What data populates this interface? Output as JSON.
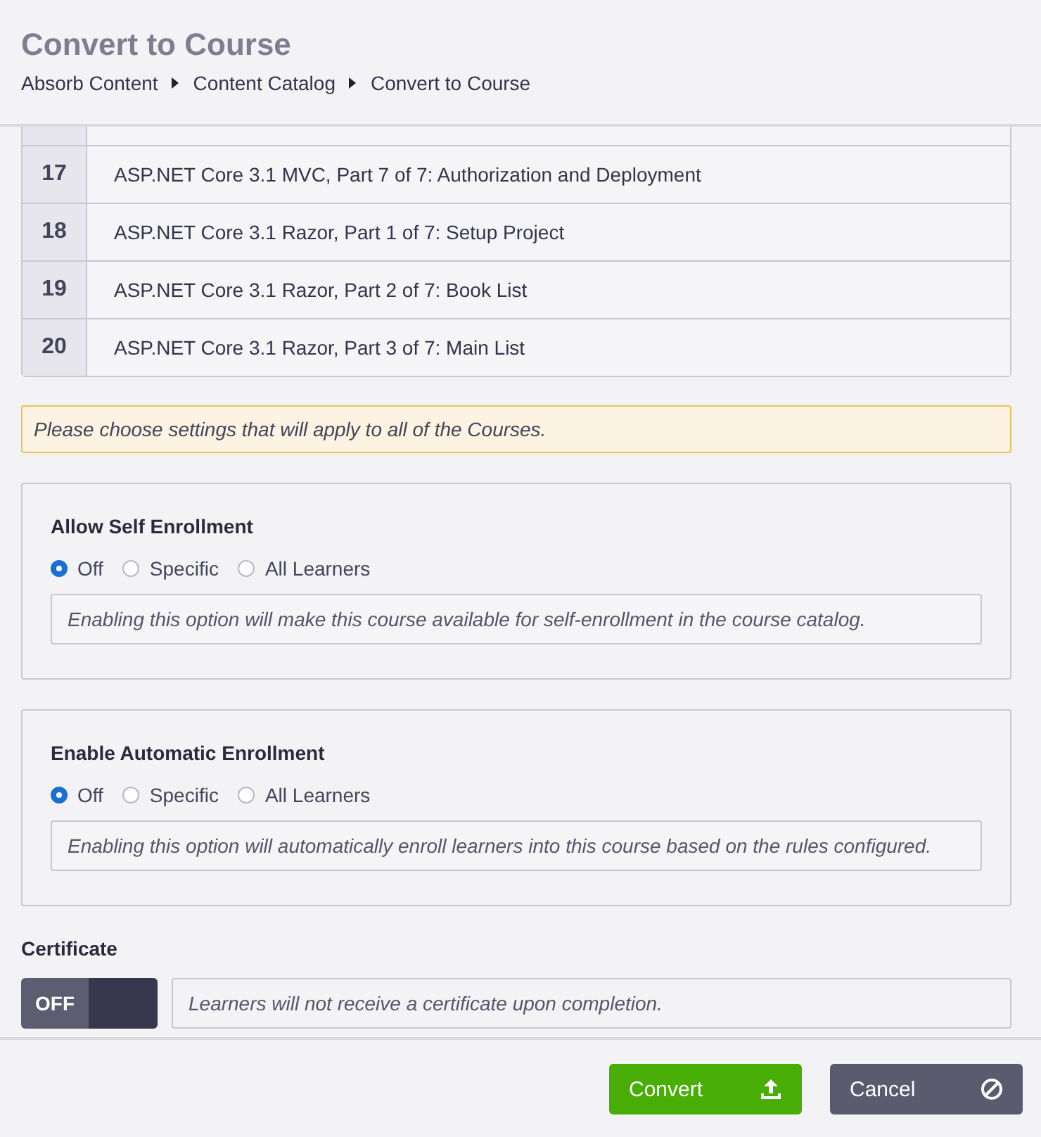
{
  "header": {
    "title": "Convert to Course",
    "breadcrumb": [
      "Absorb Content",
      "Content Catalog",
      "Convert to Course"
    ]
  },
  "table": {
    "rows": [
      {
        "number": "17",
        "title": "ASP.NET Core 3.1 MVC, Part 7 of 7: Authorization and Deployment"
      },
      {
        "number": "18",
        "title": "ASP.NET Core 3.1 Razor, Part 1 of 7: Setup Project"
      },
      {
        "number": "19",
        "title": "ASP.NET Core 3.1 Razor, Part 2 of 7: Book List"
      },
      {
        "number": "20",
        "title": "ASP.NET Core 3.1 Razor, Part 3 of 7: Main List"
      }
    ]
  },
  "notice": "Please choose settings that will apply to all of the Courses.",
  "panels": [
    {
      "title": "Allow Self Enrollment",
      "options": [
        {
          "label": "Off",
          "selected": true
        },
        {
          "label": "Specific",
          "selected": false
        },
        {
          "label": "All Learners",
          "selected": false
        }
      ],
      "description": "Enabling this option will make this course available for self-enrollment in the course catalog."
    },
    {
      "title": "Enable Automatic Enrollment",
      "options": [
        {
          "label": "Off",
          "selected": true
        },
        {
          "label": "Specific",
          "selected": false
        },
        {
          "label": "All Learners",
          "selected": false
        }
      ],
      "description": "Enabling this option will automatically enroll learners into this course based on the rules configured."
    }
  ],
  "certificate": {
    "label": "Certificate",
    "toggle_label": "OFF",
    "on": false,
    "description": "Learners will not receive a certificate upon completion."
  },
  "buttons": [
    {
      "label": "Convert",
      "kind": "primary"
    },
    {
      "label": "Cancel",
      "kind": "secondary"
    }
  ]
}
